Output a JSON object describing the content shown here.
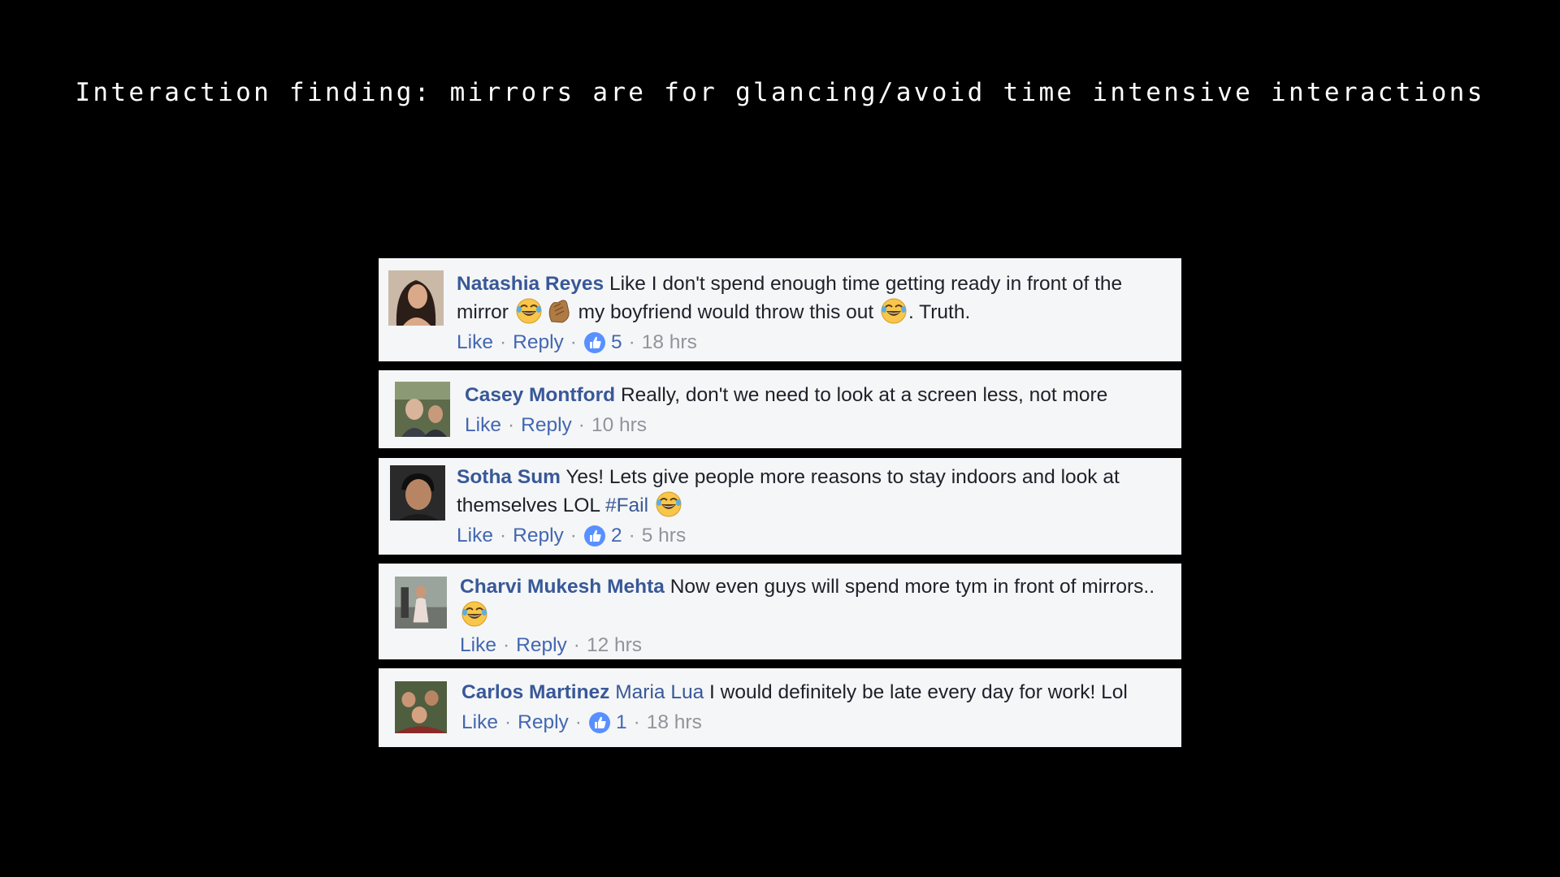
{
  "slide": {
    "title": "Interaction finding: mirrors are for glancing/avoid time intensive interactions"
  },
  "comments": [
    {
      "author": "Natashia Reyes",
      "text_parts": [
        "Like I don't spend enough time getting ready in front of the mirror",
        "my boyfriend would throw this out",
        ". Truth."
      ],
      "emojis": [
        "tears-of-joy-emoji",
        "clapping-hands-emoji",
        "tears-of-joy-emoji"
      ],
      "like_label": "Like",
      "reply_label": "Reply",
      "reactions": "5",
      "time": "18 hrs"
    },
    {
      "author": "Casey Montford",
      "text_parts": [
        "Really, don't we need to look at a screen less, not more"
      ],
      "like_label": "Like",
      "reply_label": "Reply",
      "time": "10 hrs"
    },
    {
      "author": "Sotha Sum",
      "text_parts": [
        "Yes! Lets give people more reasons to stay indoors and look at themselves LOL",
        "#Fail"
      ],
      "emojis": [
        "tears-of-joy-emoji"
      ],
      "like_label": "Like",
      "reply_label": "Reply",
      "reactions": "2",
      "time": "5 hrs"
    },
    {
      "author": "Charvi Mukesh Mehta",
      "text_parts": [
        "Now even guys will spend more tym in front of mirrors.."
      ],
      "emojis": [
        "tears-of-joy-emoji"
      ],
      "like_label": "Like",
      "reply_label": "Reply",
      "time": "12 hrs"
    },
    {
      "author": "Carlos Martinez",
      "mention": "Maria Lua",
      "text_parts": [
        "I would definitely be late every day for work! Lol"
      ],
      "like_label": "Like",
      "reply_label": "Reply",
      "reactions": "1",
      "time": "18 hrs"
    }
  ],
  "colors": {
    "background": "#000000",
    "card": "#f5f6f7",
    "author": "#385898",
    "link": "#4267b2",
    "meta": "#90949c",
    "text": "#1d2129"
  }
}
